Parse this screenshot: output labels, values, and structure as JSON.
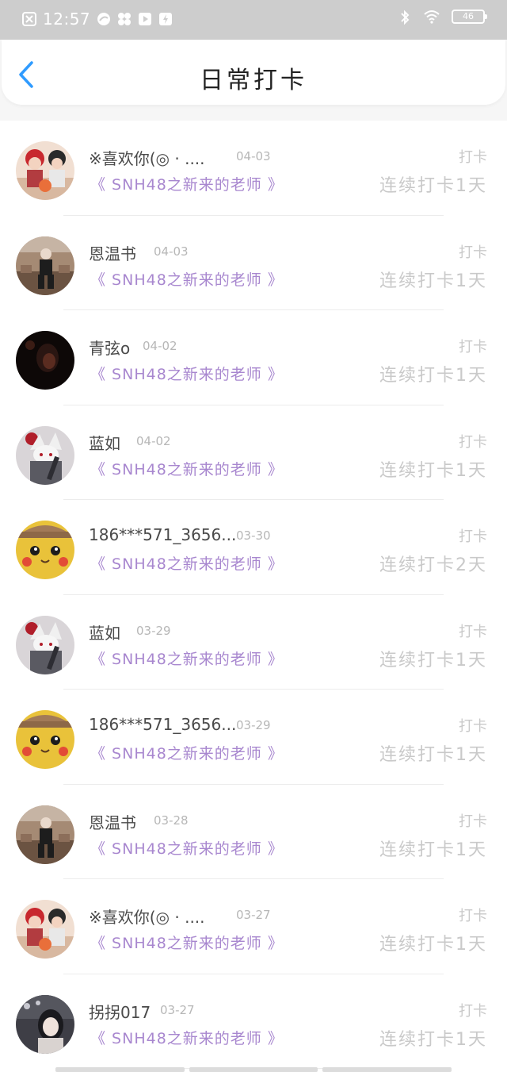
{
  "status_bar": {
    "time": "12:57",
    "battery": "46",
    "left_icons": [
      "close-box-icon",
      "cloud-icon",
      "pinwheel-icon",
      "play-icon",
      "bolt-icon"
    ],
    "right_icons": [
      "bluetooth-icon",
      "wifi-icon",
      "battery-icon"
    ]
  },
  "header": {
    "title": "日常打卡",
    "back_icon": "chevron-left-icon",
    "accent": "#2f9bff"
  },
  "colors": {
    "group_text": "#a887cf",
    "muted": "#c9c9c9"
  },
  "entries": [
    {
      "name": "※喜欢你(◎ · ....",
      "date": "04-03",
      "group": "《 SNH48之新来的老师 》",
      "label": "打卡",
      "streak": "连续打卡1天",
      "avatar": "anime-red"
    },
    {
      "name": "恩温书",
      "date": "04-03",
      "group": "《 SNH48之新来的老师 》",
      "label": "打卡",
      "streak": "连续打卡1天",
      "avatar": "man-sitting"
    },
    {
      "name": "青弦o",
      "date": "04-02",
      "group": "《 SNH48之新来的老师 》",
      "label": "打卡",
      "streak": "连续打卡1天",
      "avatar": "dark-portrait"
    },
    {
      "name": "蓝如",
      "date": "04-02",
      "group": "《 SNH48之新来的老师 》",
      "label": "打卡",
      "streak": "连续打卡1天",
      "avatar": "anime-fox"
    },
    {
      "name": "186***571_3656...",
      "date": "03-30",
      "group": "《 SNH48之新来的老师 》",
      "label": "打卡",
      "streak": "连续打卡2天",
      "avatar": "pikachu"
    },
    {
      "name": "蓝如",
      "date": "03-29",
      "group": "《 SNH48之新来的老师 》",
      "label": "打卡",
      "streak": "连续打卡1天",
      "avatar": "anime-fox"
    },
    {
      "name": "186***571_3656...",
      "date": "03-29",
      "group": "《 SNH48之新来的老师 》",
      "label": "打卡",
      "streak": "连续打卡1天",
      "avatar": "pikachu"
    },
    {
      "name": "恩温书",
      "date": "03-28",
      "group": "《 SNH48之新来的老师 》",
      "label": "打卡",
      "streak": "连续打卡1天",
      "avatar": "man-sitting"
    },
    {
      "name": "※喜欢你(◎ · ....",
      "date": "03-27",
      "group": "《 SNH48之新来的老师 》",
      "label": "打卡",
      "streak": "连续打卡1天",
      "avatar": "anime-red"
    },
    {
      "name": "拐拐017",
      "date": "03-27",
      "group": "《 SNH48之新来的老师 》",
      "label": "打卡",
      "streak": "连续打卡1天",
      "avatar": "girl-photo"
    }
  ]
}
